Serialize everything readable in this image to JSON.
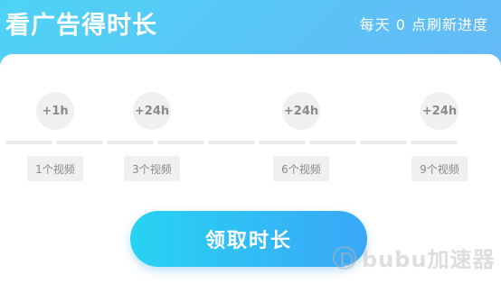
{
  "header": {
    "title": "看广告得时长",
    "note": "每天 0 点刷新进度"
  },
  "milestones": [
    {
      "reward": "+1h",
      "requirement": "1个视频"
    },
    {
      "reward": "+24h",
      "requirement": "3个视频"
    },
    {
      "reward": "+24h",
      "requirement": "6个视频"
    },
    {
      "reward": "+24h",
      "requirement": "9个视频"
    }
  ],
  "progress": {
    "videos_watched": 0,
    "total_videos": 9
  },
  "claim_button": {
    "label": "领取时长"
  },
  "watermark": {
    "text": "bubu加速器"
  },
  "colors": {
    "accent": "#3aa7f7",
    "accent_start": "#27d3f2",
    "inactive": "#f0f0f0",
    "inactive_text": "#8a8a8a"
  }
}
